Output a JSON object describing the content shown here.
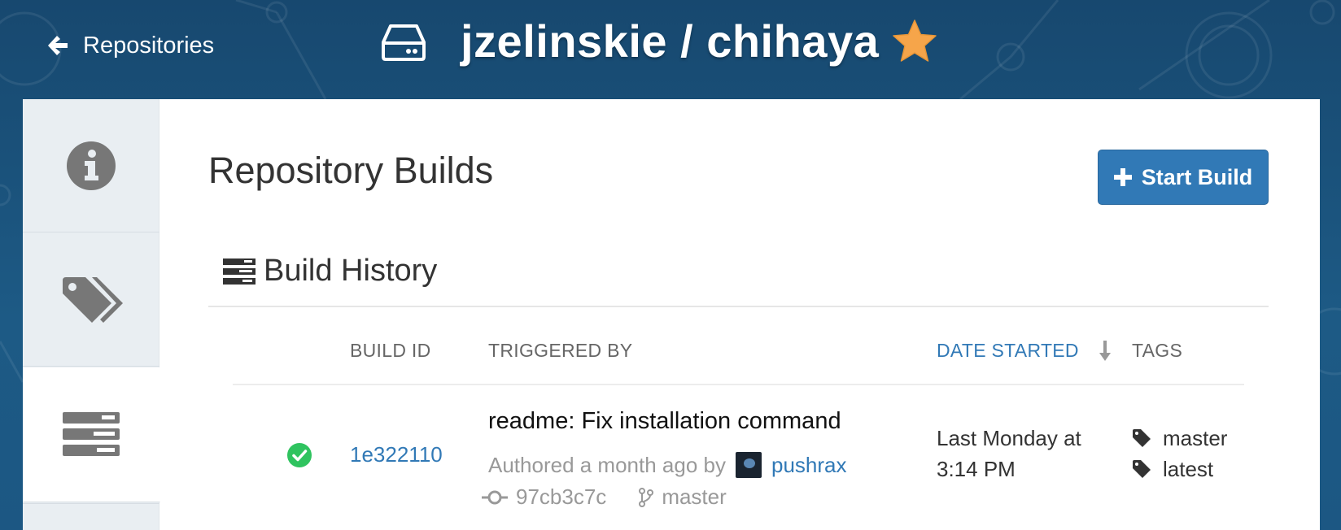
{
  "header": {
    "back_label": "Repositories",
    "repo_title": "jzelinskie / chihaya"
  },
  "nav": {
    "items": [
      {
        "name": "info",
        "icon": "info-circle-icon"
      },
      {
        "name": "tags",
        "icon": "tags-icon"
      },
      {
        "name": "builds",
        "icon": "server-stack-icon",
        "active": true
      }
    ]
  },
  "page": {
    "title": "Repository Builds",
    "start_build_label": "Start Build",
    "history_heading": "Build History"
  },
  "table": {
    "columns": {
      "build_id": "BUILD ID",
      "triggered_by": "TRIGGERED BY",
      "date_started": "DATE STARTED",
      "tags": "TAGS"
    },
    "rows": [
      {
        "status": "success",
        "build_id": "1e322110",
        "commit_message": "readme: Fix installation command",
        "authored_text": "Authored a month ago by",
        "author": "pushrax",
        "commit_sha": "97cb3c7c",
        "branch": "master",
        "date_line1": "Last Monday at",
        "date_line2": "3:14 PM",
        "tags": [
          "master",
          "latest"
        ]
      }
    ]
  },
  "colors": {
    "header_bg": "#1b4f77",
    "accent": "#3179b6",
    "star": "#f6a54a",
    "success": "#2fc35f"
  }
}
